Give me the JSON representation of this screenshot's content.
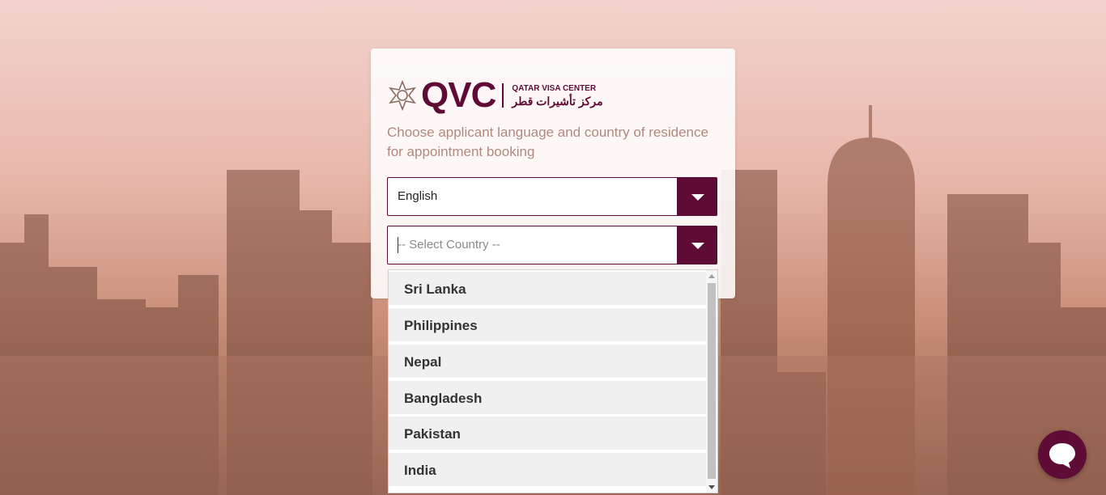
{
  "brand": {
    "logo_text": "QVC",
    "subtitle_en": "QATAR VISA CENTER",
    "subtitle_ar": "مركز تأشيرات قطر",
    "color": "#5e0b35"
  },
  "prompt": "Choose applicant language and country of residence for appointment booking",
  "language_select": {
    "value": "English"
  },
  "country_select": {
    "placeholder": "-- Select Country --",
    "options": [
      "Sri Lanka",
      "Philippines",
      "Nepal",
      "Bangladesh",
      "Pakistan",
      "India"
    ]
  },
  "icons": {
    "dropdown": "chevron-down-icon",
    "chat": "chat-bubble-icon",
    "logo_mark": "star-ornament-icon"
  }
}
